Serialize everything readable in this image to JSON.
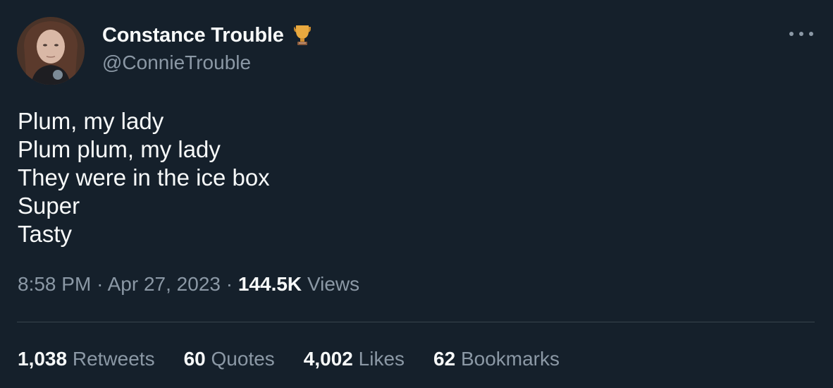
{
  "author": {
    "display_name": "Constance Trouble",
    "handle": "@ConnieTrouble",
    "badge_icon": "trophy-icon",
    "avatar_icon": "profile-photo"
  },
  "more_icon": "more-horizontal-icon",
  "tweet": {
    "lines": [
      "Plum, my lady",
      "Plum plum, my lady",
      "They were in the ice box",
      "Super",
      "Tasty"
    ]
  },
  "meta": {
    "time": "8:58 PM",
    "separator": "·",
    "date": "Apr 27, 2023",
    "views_count": "144.5K",
    "views_label": "Views"
  },
  "stats": {
    "retweets": {
      "count": "1,038",
      "label": "Retweets"
    },
    "quotes": {
      "count": "60",
      "label": "Quotes"
    },
    "likes": {
      "count": "4,002",
      "label": "Likes"
    },
    "bookmarks": {
      "count": "62",
      "label": "Bookmarks"
    }
  },
  "colors": {
    "background": "#15202b",
    "primary_text": "#f7f9f9",
    "secondary_text": "#8b98a5",
    "divider": "#38444d",
    "trophy": "#e0a03c"
  }
}
